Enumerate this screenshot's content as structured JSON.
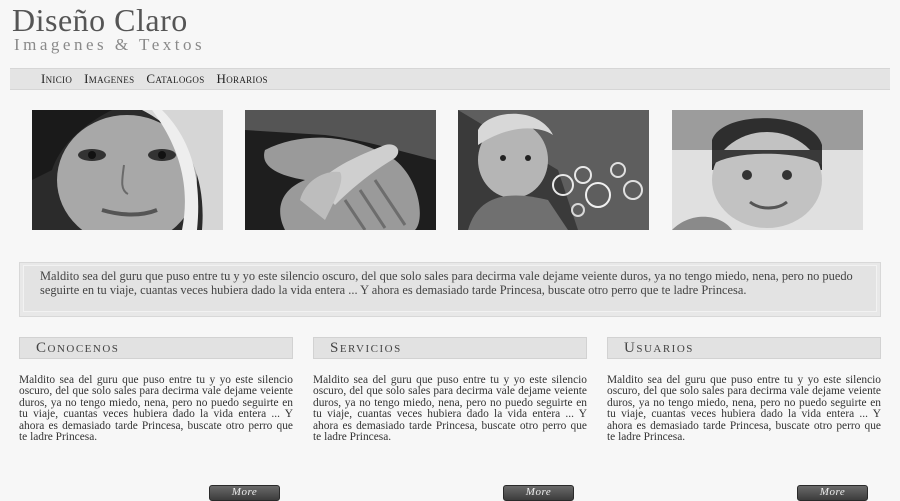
{
  "brand": {
    "title": "Diseño Claro",
    "subtitle": "Imagenes & Textos"
  },
  "nav": {
    "items": [
      "Inicio",
      "Imagenes",
      "Catalogos",
      "Horarios"
    ]
  },
  "gallery": {
    "photos": [
      "girl-face-closeup",
      "hands",
      "child-blowing-bubbles",
      "smiling-child"
    ]
  },
  "quote": {
    "text": "Maldito sea del guru que puso entre tu y yo este silencio oscuro, del que solo sales para decirma vale dejame veiente duros, ya no tengo miedo, nena, pero no puedo seguirte en tu viaje, cuantas veces hubiera dado la vida entera ... Y ahora es demasiado tarde Princesa, buscate otro perro que te ladre Princesa."
  },
  "columns": [
    {
      "title": "Conocenos",
      "text": "Maldito sea del guru que puso entre tu y yo este silencio oscuro, del que solo sales para decirma vale dejame veiente duros, ya no tengo miedo, nena, pero no puedo seguirte en tu viaje, cuantas veces hubiera dado la vida entera ... Y ahora es demasiado tarde Princesa, buscate otro perro que te ladre Princesa.",
      "button": "More"
    },
    {
      "title": "Servicios",
      "text": "Maldito sea del guru que puso entre tu y yo este silencio oscuro, del que solo sales para decirma vale dejame veiente duros, ya no tengo miedo, nena, pero no puedo seguirte en tu viaje, cuantas veces hubiera dado la vida entera ... Y ahora es demasiado tarde Princesa, buscate otro perro que te ladre Princesa.",
      "button": "More"
    },
    {
      "title": "Usuarios",
      "text": "Maldito sea del guru que puso entre tu y yo este silencio oscuro, del que solo sales para decirma vale dejame veiente duros, ya no tengo miedo, nena, pero no puedo seguirte en tu viaje, cuantas veces hubiera dado la vida entera ... Y ahora es demasiado tarde Princesa, buscate otro perro que te ladre Princesa.",
      "button": "More"
    }
  ]
}
